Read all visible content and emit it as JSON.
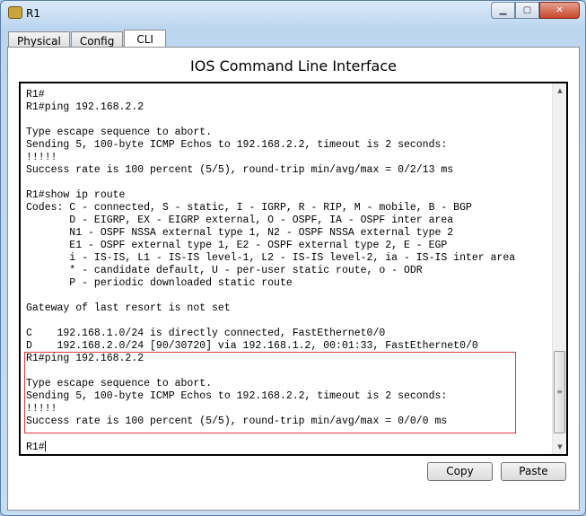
{
  "window": {
    "title": "R1",
    "icon": "router-icon",
    "controls": [
      "minimize",
      "maximize",
      "close"
    ]
  },
  "tabs": [
    {
      "label": "Physical"
    },
    {
      "label": "Config"
    },
    {
      "label": "CLI",
      "active": true
    }
  ],
  "heading": "IOS Command Line Interface",
  "terminal": {
    "lines": [
      "R1#",
      "R1#ping 192.168.2.2",
      "",
      "Type escape sequence to abort.",
      "Sending 5, 100-byte ICMP Echos to 192.168.2.2, timeout is 2 seconds:",
      "!!!!!",
      "Success rate is 100 percent (5/5), round-trip min/avg/max = 0/2/13 ms",
      "",
      "R1#show ip route",
      "Codes: C - connected, S - static, I - IGRP, R - RIP, M - mobile, B - BGP",
      "       D - EIGRP, EX - EIGRP external, O - OSPF, IA - OSPF inter area",
      "       N1 - OSPF NSSA external type 1, N2 - OSPF NSSA external type 2",
      "       E1 - OSPF external type 1, E2 - OSPF external type 2, E - EGP",
      "       i - IS-IS, L1 - IS-IS level-1, L2 - IS-IS level-2, ia - IS-IS inter area",
      "       * - candidate default, U - per-user static route, o - ODR",
      "       P - periodic downloaded static route",
      "",
      "Gateway of last resort is not set",
      "",
      "C    192.168.1.0/24 is directly connected, FastEthernet0/0",
      "D    192.168.2.0/24 [90/30720] via 192.168.1.2, 00:01:33, FastEthernet0/0",
      "R1#ping 192.168.2.2",
      "",
      "Type escape sequence to abort.",
      "Sending 5, 100-byte ICMP Echos to 192.168.2.2, timeout is 2 seconds:",
      "!!!!!",
      "Success rate is 100 percent (5/5), round-trip min/avg/max = 0/0/0 ms",
      "",
      "R1#"
    ],
    "highlight_color": "#e23b3b"
  },
  "buttons": {
    "copy": "Copy",
    "paste": "Paste"
  }
}
